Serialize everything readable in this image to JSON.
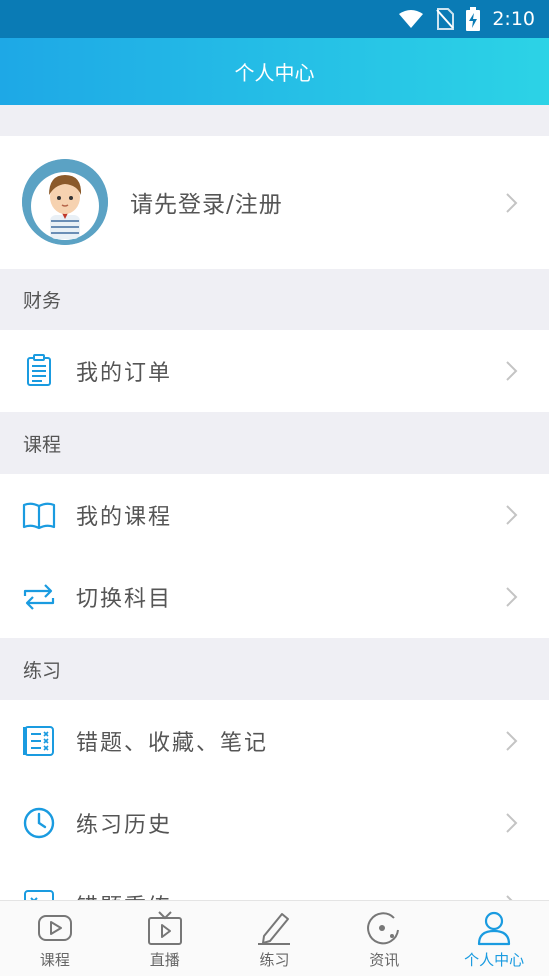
{
  "status_bar": {
    "time": "2:10"
  },
  "header": {
    "title": "个人中心"
  },
  "profile": {
    "login_text": "请先登录/注册"
  },
  "sections": {
    "finance": {
      "title": "财务",
      "items": [
        {
          "label": "我的订单",
          "icon": "clipboard-icon"
        }
      ]
    },
    "course": {
      "title": "课程",
      "items": [
        {
          "label": "我的课程",
          "icon": "open-book-icon"
        },
        {
          "label": "切换科目",
          "icon": "switch-arrows-icon"
        }
      ]
    },
    "practice": {
      "title": "练习",
      "items": [
        {
          "label": "错题、收藏、笔记",
          "icon": "checklist-icon"
        },
        {
          "label": "练习历史",
          "icon": "clock-icon"
        },
        {
          "label": "错题重练",
          "icon": "retry-icon"
        }
      ]
    }
  },
  "tabbar": {
    "tabs": [
      {
        "label": "课程",
        "icon": "video-play-icon"
      },
      {
        "label": "直播",
        "icon": "tv-live-icon"
      },
      {
        "label": "练习",
        "icon": "pencil-icon"
      },
      {
        "label": "资讯",
        "icon": "news-disc-icon"
      },
      {
        "label": "个人中心",
        "icon": "person-icon"
      }
    ],
    "active_index": 4
  },
  "colors": {
    "accent": "#1a9be0",
    "header_start": "#1ea8e6",
    "header_end": "#2cd3e6",
    "status_bar": "#0a7bb5"
  }
}
